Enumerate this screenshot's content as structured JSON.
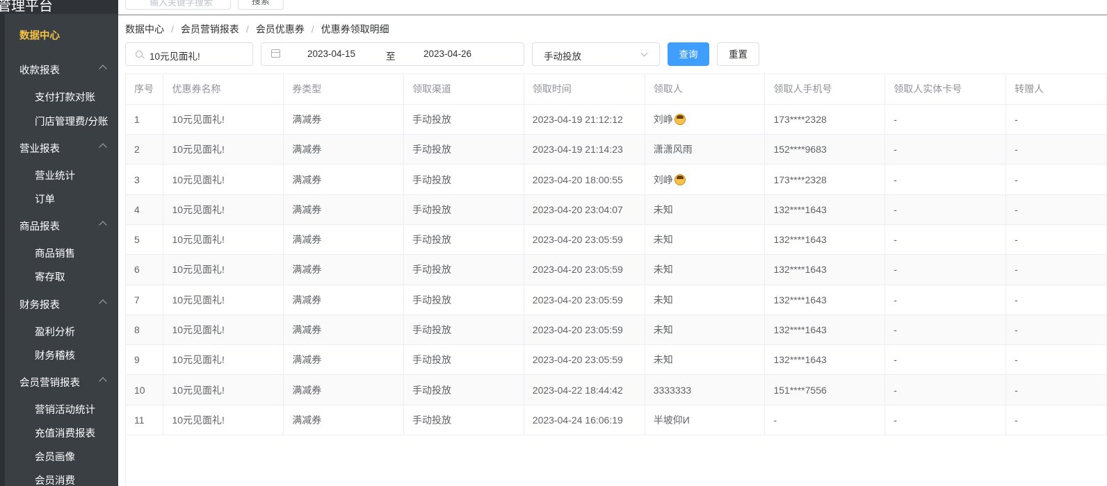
{
  "app": {
    "title": "管理平台"
  },
  "topbar": {
    "search_placeholder": "输入关键字搜索",
    "search_button": "搜索"
  },
  "sidebar": {
    "active": "数据中心",
    "groups": [
      {
        "label": "收款报表",
        "items": [
          "支付打款对账",
          "门店管理费/分账"
        ]
      },
      {
        "label": "营业报表",
        "items": [
          "营业统计",
          "订单"
        ]
      },
      {
        "label": "商品报表",
        "items": [
          "商品销售",
          "寄存取"
        ]
      },
      {
        "label": "财务报表",
        "items": [
          "盈利分析",
          "财务稽核"
        ]
      },
      {
        "label": "会员营销报表",
        "items": [
          "营销活动统计",
          "充值消费报表",
          "会员画像",
          "会员消费"
        ]
      }
    ]
  },
  "breadcrumb": [
    "数据中心",
    "会员营销报表",
    "会员优惠券",
    "优惠券领取明细"
  ],
  "breadcrumb_sep": "/",
  "filters": {
    "coupon_name": "10元见面礼!",
    "date_start": "2023-04-15",
    "date_to": "至",
    "date_end": "2023-04-26",
    "channel": "手动投放"
  },
  "buttons": {
    "query": "查询",
    "reset": "重置"
  },
  "table": {
    "columns": [
      "序号",
      "优惠券名称",
      "券类型",
      "领取渠道",
      "领取时间",
      "领取人",
      "领取人手机号",
      "领取人实体卡号",
      "转赠人"
    ],
    "rows": [
      [
        "1",
        "10元见面礼!",
        "满减券",
        "手动投放",
        "2023-04-19 21:12:12",
        "刘峥",
        "173****2328",
        "-",
        "-"
      ],
      [
        "2",
        "10元见面礼!",
        "满减券",
        "手动投放",
        "2023-04-19 21:14:23",
        "潇潇风雨",
        "152****9683",
        "-",
        "-"
      ],
      [
        "3",
        "10元见面礼!",
        "满减券",
        "手动投放",
        "2023-04-20 18:00:55",
        "刘峥",
        "173****2328",
        "-",
        "-"
      ],
      [
        "4",
        "10元见面礼!",
        "满减券",
        "手动投放",
        "2023-04-20 23:04:07",
        "未知",
        "132****1643",
        "-",
        "-"
      ],
      [
        "5",
        "10元见面礼!",
        "满减券",
        "手动投放",
        "2023-04-20 23:05:59",
        "未知",
        "132****1643",
        "-",
        "-"
      ],
      [
        "6",
        "10元见面礼!",
        "满减券",
        "手动投放",
        "2023-04-20 23:05:59",
        "未知",
        "132****1643",
        "-",
        "-"
      ],
      [
        "7",
        "10元见面礼!",
        "满减券",
        "手动投放",
        "2023-04-20 23:05:59",
        "未知",
        "132****1643",
        "-",
        "-"
      ],
      [
        "8",
        "10元见面礼!",
        "满减券",
        "手动投放",
        "2023-04-20 23:05:59",
        "未知",
        "132****1643",
        "-",
        "-"
      ],
      [
        "9",
        "10元见面礼!",
        "满减券",
        "手动投放",
        "2023-04-20 23:05:59",
        "未知",
        "132****1643",
        "-",
        "-"
      ],
      [
        "10",
        "10元见面礼!",
        "满减券",
        "手动投放",
        "2023-04-22 18:44:42",
        "3333333",
        "151****7556",
        "-",
        "-"
      ],
      [
        "11",
        "10元见面礼!",
        "满减券",
        "手动投放",
        "2023-04-24 16:06:19",
        "半坡仰И",
        "-",
        "-",
        "-"
      ]
    ],
    "avatar_emoji_rows": [
      0,
      2
    ]
  },
  "colors": {
    "sidebar_bg": "#3a3f44",
    "active": "#f6c244",
    "primary": "#409eff"
  },
  "icons": {
    "search": "search-icon",
    "calendar": "calendar-icon",
    "chevron": "chevron-up-icon",
    "caret": "chevron-down-icon",
    "emoji": "emoji-avatar-icon"
  }
}
